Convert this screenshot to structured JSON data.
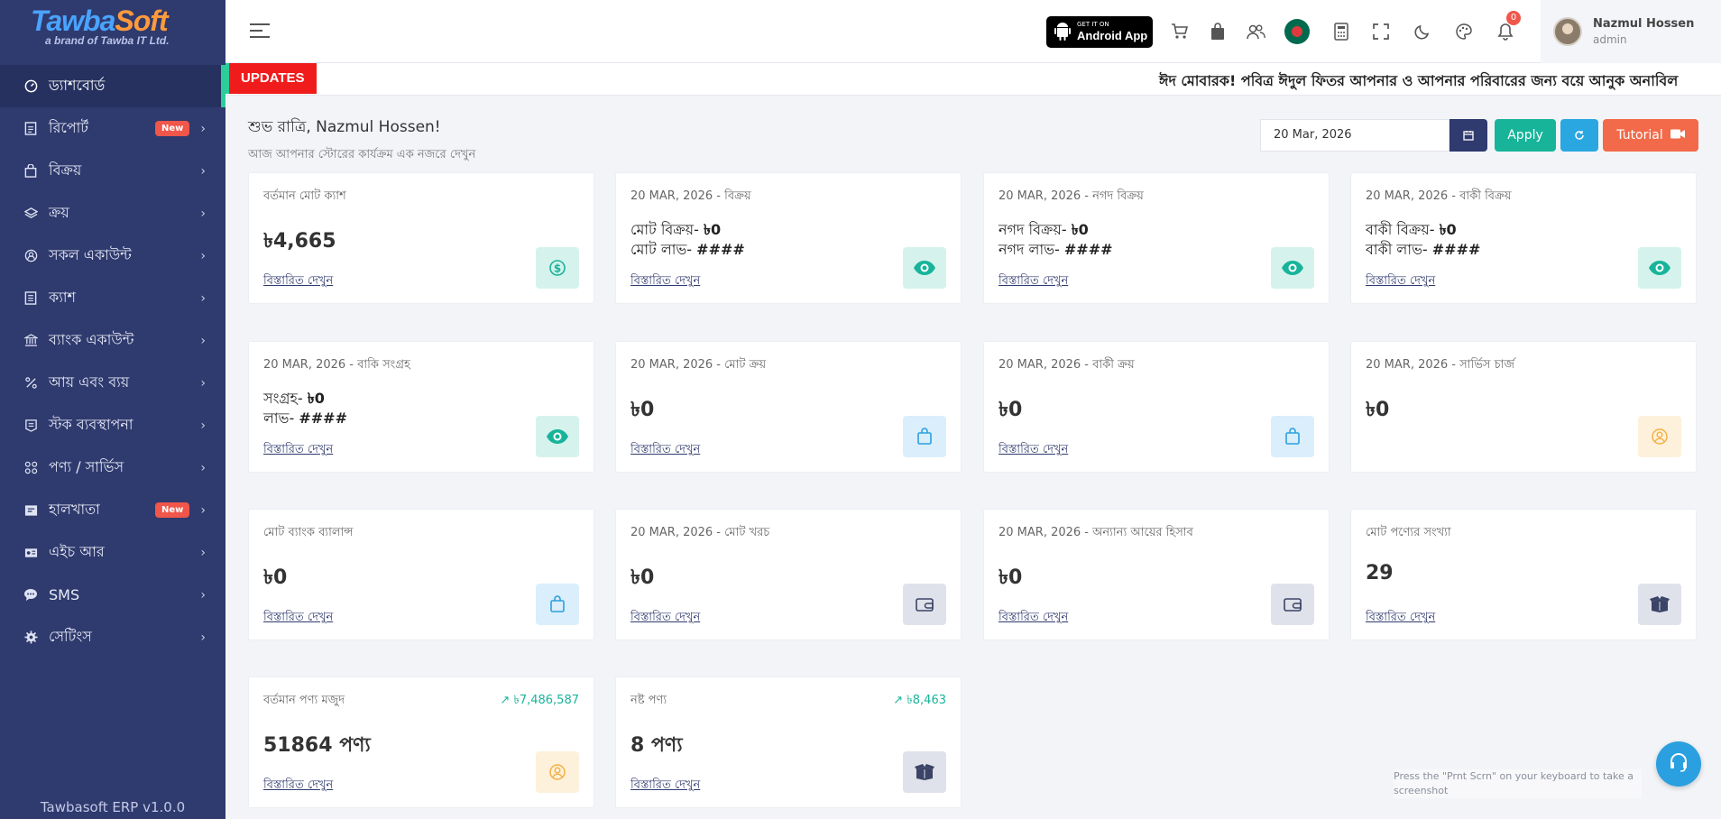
{
  "brand": {
    "part1": "Tawba",
    "part2": "Soft",
    "tagline": "a brand of Tawba IT Ltd."
  },
  "sidebar": {
    "items": [
      {
        "label": "ড্যাশবোর্ড",
        "icon": "dashboard-icon"
      },
      {
        "label": "রিপোর্ট",
        "badge": "New",
        "icon": "report-icon"
      },
      {
        "label": "বিক্রয়",
        "icon": "sale-bag-icon"
      },
      {
        "label": "ক্রয়",
        "icon": "layers-icon"
      },
      {
        "label": "সকল একাউন্ট",
        "icon": "account-icon"
      },
      {
        "label": "ক্যাশ",
        "icon": "cash-icon"
      },
      {
        "label": "ব্যাংক একাউন্ট",
        "icon": "bank-icon"
      },
      {
        "label": "আয় এবং ব্যয়",
        "icon": "percent-icon"
      },
      {
        "label": "স্টক ব্যবস্থাপনা",
        "icon": "stock-icon"
      },
      {
        "label": "পণ্য / সার্ভিস",
        "icon": "product-grid-icon"
      },
      {
        "label": "হালখাতা",
        "badge": "New",
        "icon": "ledger-icon"
      },
      {
        "label": "এইচ আর",
        "icon": "hr-icon"
      },
      {
        "label": "SMS",
        "icon": "sms-icon"
      },
      {
        "label": "সেটিংস",
        "icon": "settings-icon"
      }
    ],
    "version": "Tawbasoft ERP v1.0.0"
  },
  "topbar": {
    "android": {
      "small": "GET IT ON",
      "big": "Android App"
    },
    "notif_count": "0",
    "user": {
      "name": "Nazmul Hossen",
      "role": "admin"
    }
  },
  "updates": {
    "tag": "UPDATES",
    "message": "ঈদ মোবারক! পবিত্র ঈদুল ফিতর আপনার ও আপনার পরিবারের জন্য বয়ে আনুক অনাবিল"
  },
  "greeting": {
    "title": "শুভ রাত্রি, Nazmul Hossen!",
    "subtitle": "আজ আপনার স্টোরের কার্যক্রম এক নজরে দেখুন"
  },
  "toolbar": {
    "date": "20 Mar, 2026",
    "apply": "Apply",
    "tutorial": "Tutorial"
  },
  "cards": [
    {
      "title": "বর্তমান মোট ক্যাশ",
      "value": "৳4,665",
      "link": "বিস্তারিত দেখুন"
    },
    {
      "title": "20 MAR, 2026 - বিক্রয়",
      "l1": "মোট বিক্রয়- ",
      "v1": "৳0",
      "l2": "মোট লাভ- ",
      "v2": "####",
      "link": "বিস্তারিত দেখুন"
    },
    {
      "title": "20 MAR, 2026 - নগদ বিক্রয়",
      "l1": "নগদ বিক্রয়- ",
      "v1": "৳0",
      "l2": "নগদ লাভ- ",
      "v2": "####",
      "link": "বিস্তারিত দেখুন"
    },
    {
      "title": "20 MAR, 2026 - বাকী বিক্রয়",
      "l1": "বাকী বিক্রয়- ",
      "v1": "৳0",
      "l2": "বাকী লাভ- ",
      "v2": "####",
      "link": "বিস্তারিত দেখুন"
    },
    {
      "title": "20 MAR, 2026 - বাকি সংগ্রহ",
      "l1": "সংগ্রহ- ",
      "v1": "৳0",
      "l2": "লাভ- ",
      "v2": "####",
      "link": "বিস্তারিত দেখুন"
    },
    {
      "title": "20 MAR, 2026 - মোট ক্রয়",
      "value": "৳0",
      "link": "বিস্তারিত দেখুন"
    },
    {
      "title": "20 MAR, 2026 - বাকী ক্রয়",
      "value": "৳0",
      "link": "বিস্তারিত দেখুন"
    },
    {
      "title": "20 MAR, 2026 - সার্ভিস চার্জ",
      "value": "৳0"
    },
    {
      "title": "মোট ব্যাংক ব্যালান্স",
      "value": "৳0",
      "link": "বিস্তারিত দেখুন"
    },
    {
      "title": "20 MAR, 2026 - মোট খরচ",
      "value": "৳0",
      "link": "বিস্তারিত দেখুন"
    },
    {
      "title": "20 MAR, 2026 - অন্যান্য আয়ের হিসাব",
      "value": "৳0",
      "link": "বিস্তারিত দেখুন"
    },
    {
      "title": "মোট পণ্যের সংখ্যা",
      "value": "29",
      "link": "বিস্তারিত দেখুন"
    },
    {
      "title": "বর্তমান পণ্য মজুদ",
      "trend": "৳7,486,587",
      "value": "51864 পণ্য",
      "link": "বিস্তারিত দেখুন"
    },
    {
      "title": "নষ্ট পণ্য",
      "trend": "৳8,463",
      "value": "8 পণ্য",
      "link": "বিস্তারিত দেখুন"
    }
  ],
  "watermark": "Press the \"Prnt Scrn\" on your keyboard to take a screenshot",
  "colors": {
    "sidebar": "#2f3a6e",
    "accent": "#18b49a",
    "danger": "#f01c1c",
    "tutorial": "#f26a49"
  }
}
